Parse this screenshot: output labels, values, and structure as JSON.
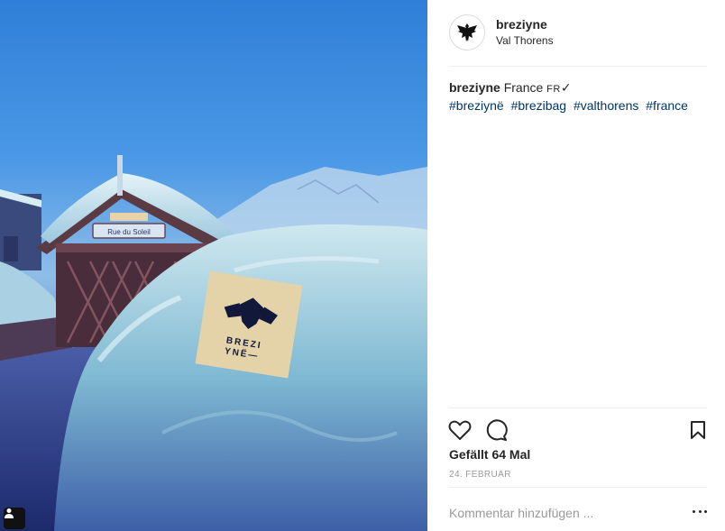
{
  "post": {
    "image_label": "post photo",
    "username": "breziyne",
    "location": "Val Thorens",
    "caption": {
      "user": "breziyne",
      "text": "France",
      "flag": "FR",
      "check": "✓",
      "hashtags": [
        "#breziynë",
        "#brezibag",
        "#valthorens",
        "#france"
      ]
    },
    "likes": "Gefällt 64 Mal",
    "date": "24. FEBRUAR",
    "comment_placeholder": "Kommentar hinzufügen ...",
    "photo_text": {
      "sign": "Rue du Soleil",
      "bag_line1": "BREZI",
      "bag_line2": "YNË—"
    }
  },
  "icons": {
    "like": "heart-icon",
    "comment": "comment-icon",
    "save": "bookmark-icon",
    "more": "more-options-icon",
    "user_tag": "user-tag-icon",
    "avatar": "eagle-logo-icon"
  },
  "colors": {
    "hashtag": "#003569",
    "border": "#efefef",
    "muted": "#999999"
  }
}
